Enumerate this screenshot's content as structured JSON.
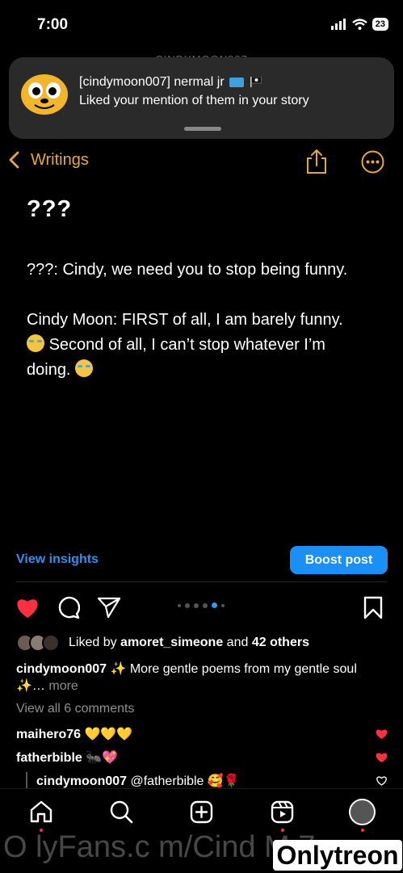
{
  "status_bar": {
    "time": "7:00",
    "battery": "23"
  },
  "background_header": {
    "username": "CINDYMOON007"
  },
  "notification": {
    "title": "[cindymoon007] nermal jr",
    "body": "Liked your mention of them in your story"
  },
  "notes_header": {
    "back_label": "Writings"
  },
  "note": {
    "title": "???",
    "line1": "???: Cindy, we need you to stop being funny.",
    "line2a": "Cindy Moon: FIRST of all, I am barely funny.",
    "line2b": "Second of all, I can’t stop whatever I’m",
    "line2c": "doing."
  },
  "insights": {
    "view_label": "View insights",
    "boost_label": "Boost post"
  },
  "likes": {
    "prefix": "Liked by",
    "user": "amoret_simeone",
    "joiner": "and",
    "others": "42 others"
  },
  "caption": {
    "user": "cindymoon007",
    "text": "✨ More gentle poems from my gentle soul ✨…",
    "more": "more"
  },
  "comments": {
    "view_all": "View all 6 comments",
    "items": [
      {
        "user": "maihero76",
        "text": "💛💛💛"
      },
      {
        "user": "fatherbible",
        "text": "🐜💖"
      }
    ],
    "reply": {
      "user": "cindymoon007",
      "text": "@fatherbible 🥰🌹"
    }
  },
  "watermark": {
    "text": "O lyFans.c m/Cind  M    7",
    "logo": "Onlytreon"
  },
  "colors": {
    "accent_notes": "#e4a93b",
    "link_blue": "#2f8ff0",
    "boost_blue": "#1a8ff5",
    "like_red": "#ff3040"
  },
  "carousel": {
    "count": 6,
    "active_index": 4
  }
}
